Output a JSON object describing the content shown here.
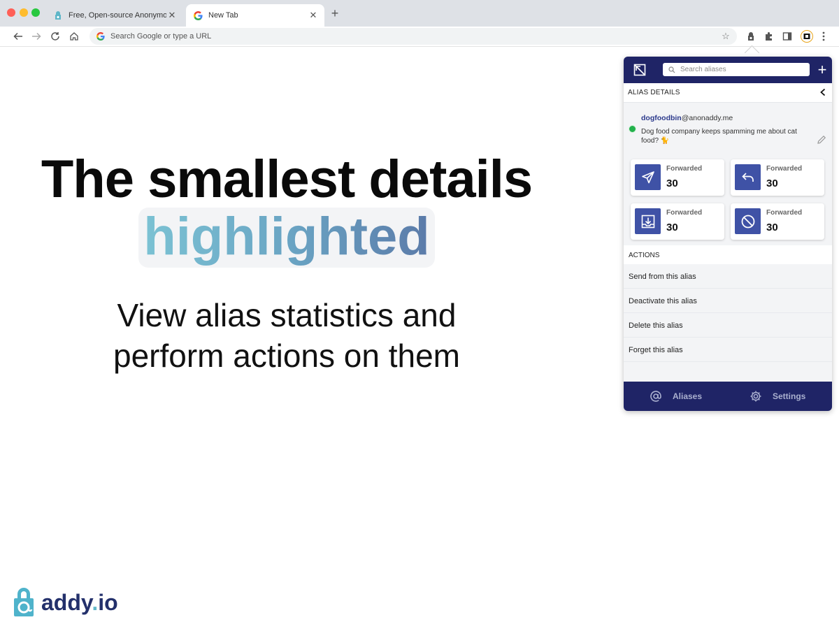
{
  "browser": {
    "tabs": [
      {
        "title": "Free, Open-source Anonymou",
        "active": false
      },
      {
        "title": "New Tab",
        "active": true
      }
    ],
    "omnibox_placeholder": "Search Google or type a URL"
  },
  "hero": {
    "title": "The smallest details",
    "highlight": "highlighted",
    "subtitle_line1": "View alias statistics and",
    "subtitle_line2": "perform actions on them"
  },
  "brand": {
    "name_main": "addy",
    "name_dot": ".",
    "name_tld": "io"
  },
  "popup": {
    "search_placeholder": "Search aliases",
    "section_title": "ALIAS DETAILS",
    "alias": {
      "local_part": "dogfoodbin",
      "domain": "@anonaddy.me",
      "description": "Dog food company keeps spamming me about cat food? 🐈",
      "active": true
    },
    "stats": [
      {
        "label": "Forwarded",
        "value": "30",
        "icon": "send-icon"
      },
      {
        "label": "Forwarded",
        "value": "30",
        "icon": "reply-icon"
      },
      {
        "label": "Forwarded",
        "value": "30",
        "icon": "inbox-download-icon"
      },
      {
        "label": "Forwarded",
        "value": "30",
        "icon": "blocked-icon"
      }
    ],
    "actions_title": "ACTIONS",
    "actions": [
      "Send from this alias",
      "Deactivate this alias",
      "Delete this alias",
      "Forget this alias"
    ],
    "footer": {
      "aliases": "Aliases",
      "settings": "Settings"
    }
  },
  "colors": {
    "popup_navy": "#1f2466",
    "icon_blue": "#3f52a6",
    "status_green": "#22b14c",
    "brand_navy": "#23306b",
    "brand_teal": "#62b8c9"
  }
}
